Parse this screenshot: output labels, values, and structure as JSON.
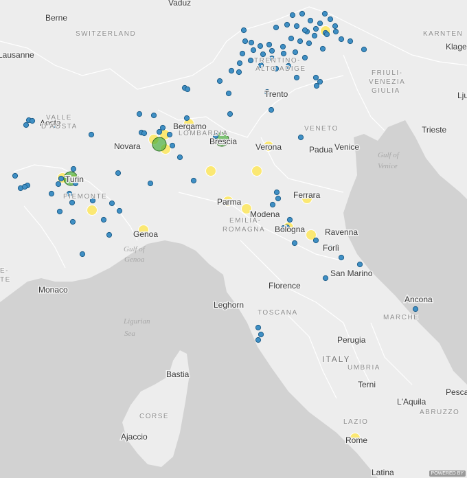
{
  "map": {
    "colors": {
      "land": "#ededed",
      "sea": "#d2d2d2",
      "border": "#ffffff",
      "blue_marker": "#3f8fc4",
      "yellow_marker": "#ffe64a",
      "green_marker": "#4caf3f"
    },
    "cities": [
      "Berne",
      "Vaduz",
      "Lausanne",
      "Aosta",
      "Bergamo",
      "Brescia",
      "Novara",
      "Turin",
      "Trento",
      "Verona",
      "Padua",
      "Venice",
      "Trieste",
      "Klage",
      "Lju",
      "Parma",
      "Modena",
      "Ferrara",
      "Bologna",
      "Ravenna",
      "Forlì",
      "San Marino",
      "Genoa",
      "Monaco",
      "Florence",
      "Leghorn",
      "Ancona",
      "Perugia",
      "Terni",
      "L'Aquila",
      "Pesca",
      "Bastia",
      "Ajaccio",
      "Rome",
      "Latina"
    ],
    "regions": [
      "SWITZERLAND",
      "VALLE",
      "D'AOSTA",
      "LOMBARDIA",
      "PIEMONTE",
      "TRENTINO-",
      "ALTO ADIGE",
      "VENETO",
      "FRIULI-",
      "VENEZIA",
      "GIULIA",
      "KARNTEN",
      "EMILIA-",
      "ROMAGNA",
      "TOSCANA",
      "MARCHE",
      "UMBRIA",
      "LAZIO",
      "ABRUZZO",
      "CORSE",
      "E-",
      "TE"
    ],
    "water": [
      "Gulf of",
      "Venice",
      "Gulf of",
      "Genoa",
      "Ligurian",
      "Sea"
    ],
    "country": "ITALY",
    "attribution": "POWERED BY"
  }
}
